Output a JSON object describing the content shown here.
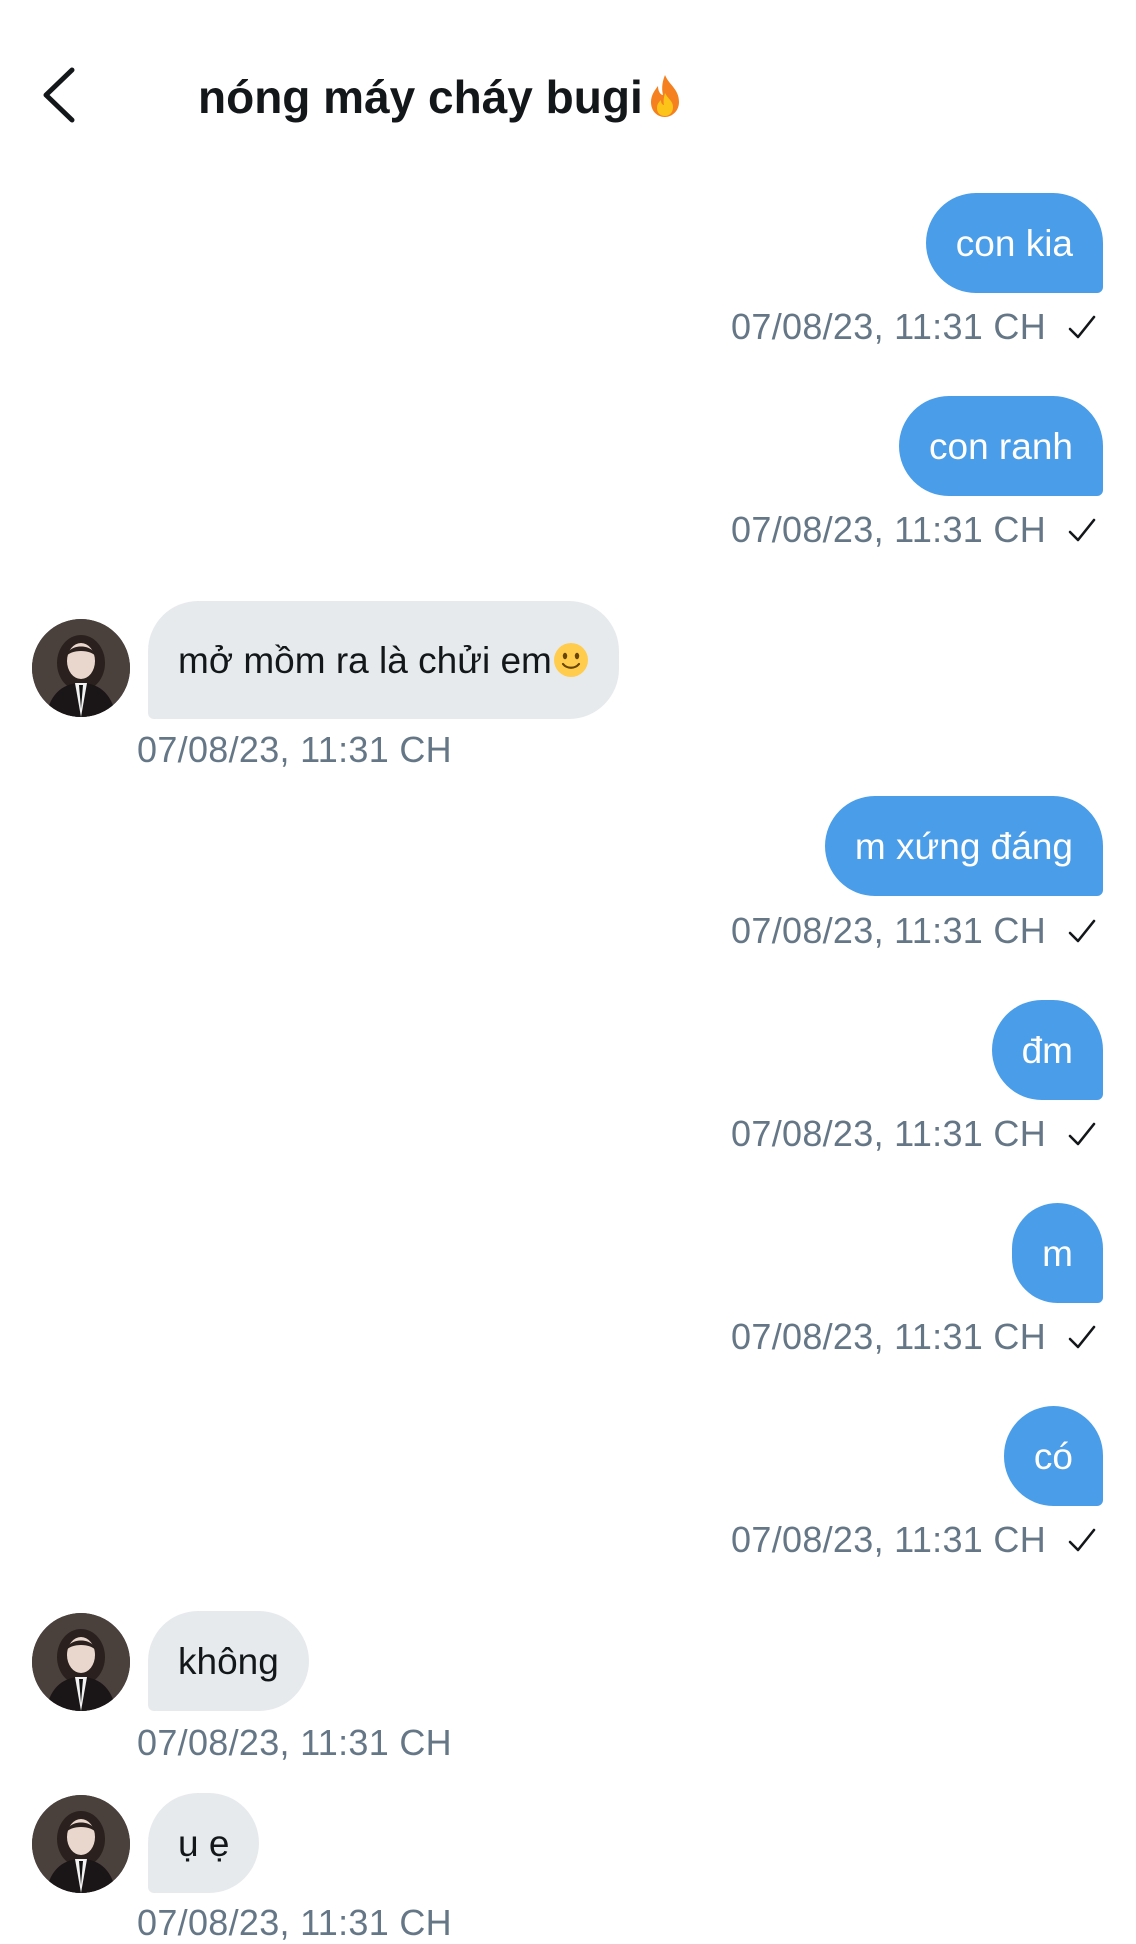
{
  "header": {
    "back_icon": "chevron-left-icon",
    "title": "nóng máy cháy bugi",
    "title_emoji": "fire-emoji"
  },
  "colors": {
    "outgoing_bubble": "#4a9de8",
    "incoming_bubble": "#e7eaed",
    "timestamp": "#657786",
    "text": "#14171a"
  },
  "messages": [
    {
      "direction": "out",
      "text": "con kia",
      "time": "07/08/23, 11:31 CH",
      "read_icon": "check-icon"
    },
    {
      "direction": "out",
      "text": "con ranh",
      "time": "07/08/23, 11:31 CH",
      "read_icon": "check-icon"
    },
    {
      "direction": "in",
      "text": "mở mồm ra là chửi em",
      "emoji": "slightly-smiling-face-emoji",
      "time": "07/08/23, 11:31 CH"
    },
    {
      "direction": "out",
      "text": "m xứng đáng",
      "time": "07/08/23, 11:31 CH",
      "read_icon": "check-icon"
    },
    {
      "direction": "out",
      "text": "đm",
      "time": "07/08/23, 11:31 CH",
      "read_icon": "check-icon"
    },
    {
      "direction": "out",
      "text": "m",
      "time": "07/08/23, 11:31 CH",
      "read_icon": "check-icon"
    },
    {
      "direction": "out",
      "text": "có",
      "time": "07/08/23, 11:31 CH",
      "read_icon": "check-icon"
    },
    {
      "direction": "in",
      "text": "không",
      "time": "07/08/23, 11:31 CH"
    },
    {
      "direction": "in",
      "text": "ụ ẹ",
      "time": "07/08/23, 11:31 CH"
    }
  ]
}
